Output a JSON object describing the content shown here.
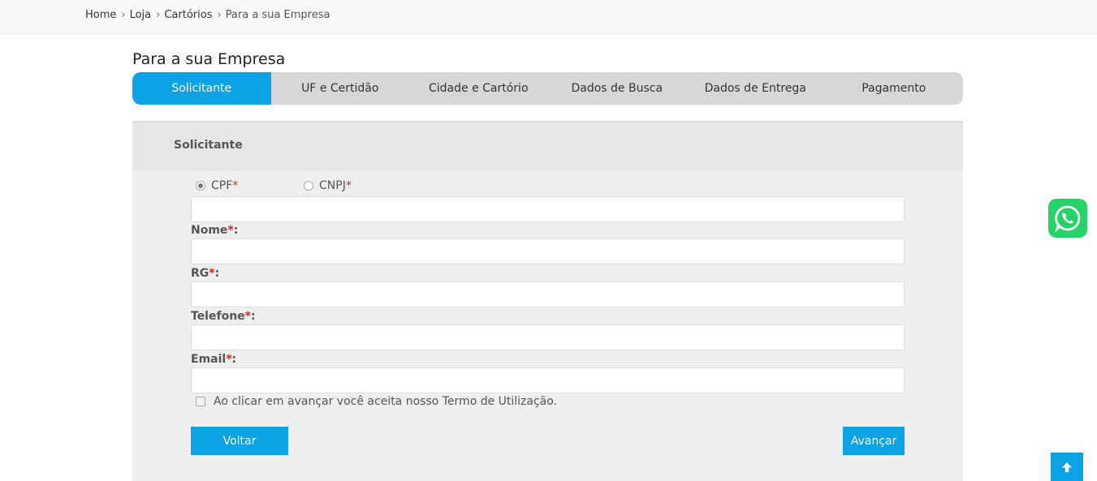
{
  "breadcrumb": {
    "items": [
      "Home",
      "Loja",
      "Cartórios",
      "Para a sua Empresa"
    ],
    "separator": "›"
  },
  "page": {
    "title": "Para a sua Empresa"
  },
  "steps": [
    {
      "label": "Solicitante",
      "active": true
    },
    {
      "label": "UF e Certidão",
      "active": false
    },
    {
      "label": "Cidade e Cartório",
      "active": false
    },
    {
      "label": "Dados de Busca",
      "active": false
    },
    {
      "label": "Dados de Entrega",
      "active": false
    },
    {
      "label": "Pagamento",
      "active": false
    }
  ],
  "section": {
    "title": "Solicitante"
  },
  "doc_type": {
    "options": [
      {
        "label": "CPF",
        "required_mark": "*",
        "checked": true
      },
      {
        "label": "CNPJ",
        "required_mark": "*",
        "checked": false
      }
    ],
    "value": ""
  },
  "fields": {
    "nome": {
      "label": "Nome",
      "required_mark": "*",
      "suffix": ":",
      "value": ""
    },
    "rg": {
      "label": "RG",
      "required_mark": "*",
      "suffix": ":",
      "value": ""
    },
    "telefone": {
      "label": "Telefone",
      "required_mark": "*",
      "suffix": ":",
      "value": ""
    },
    "email": {
      "label": "Email",
      "required_mark": "*",
      "suffix": ":",
      "value": ""
    }
  },
  "terms": {
    "label": "Ao clicar em avançar você aceita nosso Termo de Utilização.",
    "checked": false
  },
  "buttons": {
    "back": "Voltar",
    "next": "Avançar"
  },
  "floating": {
    "whatsapp_icon": "whatsapp-icon",
    "to_top_icon": "arrow-up-icon"
  },
  "colors": {
    "accent": "#0ca2e6",
    "whatsapp": "#25d366",
    "required": "#e02020"
  }
}
